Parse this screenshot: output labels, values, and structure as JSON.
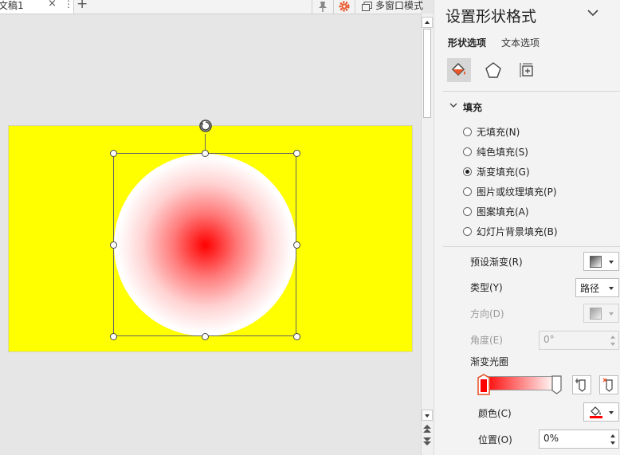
{
  "tabbar": {
    "doc_tab": "文稿1",
    "close_glyph": "×",
    "more_glyph": "⋮",
    "add_glyph": "+",
    "multi_window": "多窗口模式"
  },
  "pane": {
    "title": "设置形状格式",
    "tabs": {
      "shape": "形状选项",
      "text": "文本选项"
    },
    "section_fill": "填充",
    "fill_options": [
      {
        "label": "无填充(N)",
        "selected": false
      },
      {
        "label": "纯色填充(S)",
        "selected": false
      },
      {
        "label": "渐变填充(G)",
        "selected": true
      },
      {
        "label": "图片或纹理填充(P)",
        "selected": false
      },
      {
        "label": "图案填充(A)",
        "selected": false
      },
      {
        "label": "幻灯片背景填充(B)",
        "selected": false
      }
    ],
    "preset_gradient_label": "预设渐变(R)",
    "type_label": "类型(Y)",
    "type_value": "路径",
    "direction_label": "方向(D)",
    "angle_label": "角度(E)",
    "angle_value": "0°",
    "gradient_stops_label": "渐变光圈",
    "color_label": "颜色(C)",
    "position_label": "位置(O)",
    "position_value": "0%"
  },
  "colors": {
    "slide_background": "#ffff00",
    "gradient_center": "#ff0000",
    "gradient_edge": "#ffffff",
    "accent_orange": "#e8562a",
    "color_swatch": "#ff0000"
  },
  "icons": {
    "fill_line": "paint-bucket-icon",
    "effects": "pentagon-icon",
    "size_properties": "size-properties-icon",
    "rotate": "rotate-icon"
  }
}
